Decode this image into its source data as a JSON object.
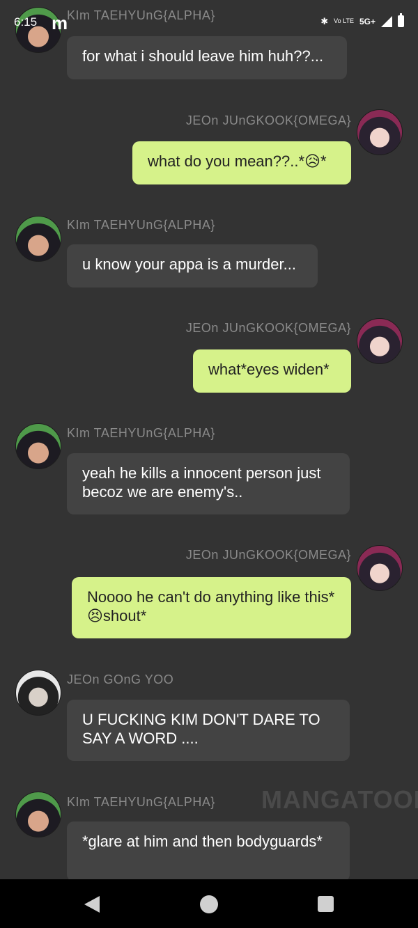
{
  "status": {
    "time": "6:15",
    "app_icon": "m",
    "volte": "Vo LTE",
    "network": "5G+",
    "icons": [
      "bluetooth-icon",
      "signal-icon",
      "battery-icon"
    ]
  },
  "messages": [
    {
      "side": "left",
      "speaker": "KIm TAEHYUnG{ALPHA}",
      "text": "for what i should leave him huh??..."
    },
    {
      "side": "right",
      "speaker": "JEOn JUnGKOOK{OMEGA}",
      "text": "what do you mean??..*😥*"
    },
    {
      "side": "left",
      "speaker": "KIm TAEHYUnG{ALPHA}",
      "text": "u know your appa is a murder..."
    },
    {
      "side": "right",
      "speaker": "JEOn JUnGKOOK{OMEGA}",
      "text": "what*eyes widen*"
    },
    {
      "side": "left",
      "speaker": "KIm TAEHYUnG{ALPHA}",
      "text": "yeah he kills a innocent person just becoz we are enemy's.."
    },
    {
      "side": "right",
      "speaker": "JEOn JUnGKOOK{OMEGA}",
      "text": "Noooo he can't do anything like this*😣shout*"
    },
    {
      "side": "left",
      "speaker": "JEOn GOnG YOO",
      "text": "U FUCKING KIM DON'T DARE TO SAY A WORD ...."
    },
    {
      "side": "left",
      "speaker": "KIm TAEHYUnG{ALPHA}",
      "text": "*glare at him and then bodyguards*"
    }
  ],
  "watermark": "MANGATOON",
  "navbar": {
    "icons": [
      "back-icon",
      "home-icon",
      "recents-icon"
    ]
  },
  "colors": {
    "background": "#333333",
    "left_bubble": "#434343",
    "right_bubble": "#d6f28a"
  }
}
